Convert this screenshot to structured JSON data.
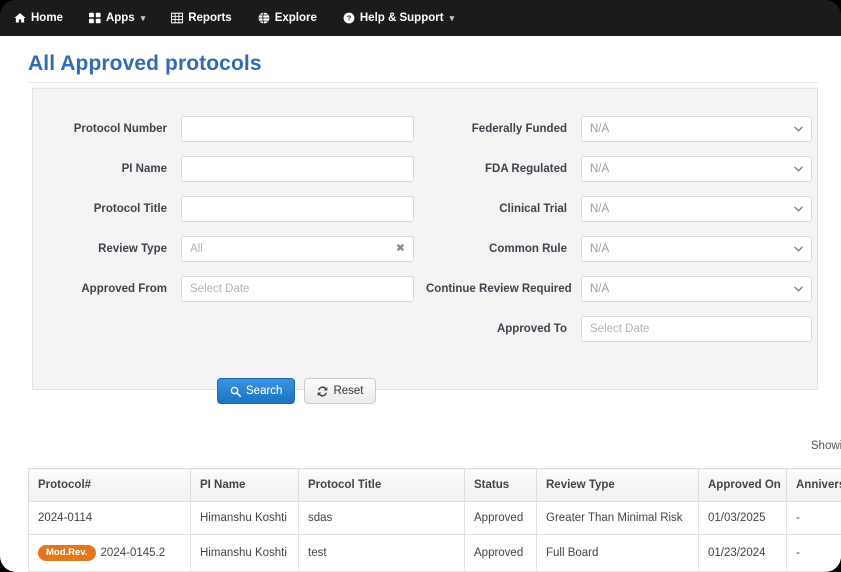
{
  "navbar": {
    "items": [
      {
        "label": "Home",
        "icon": "home-icon",
        "caret": false
      },
      {
        "label": "Apps",
        "icon": "grid-icon",
        "caret": true,
        "caret_glyph": "▾"
      },
      {
        "label": "Reports",
        "icon": "table-icon",
        "caret": false
      },
      {
        "label": "Explore",
        "icon": "globe-icon",
        "caret": false
      },
      {
        "label": "Help & Support",
        "icon": "question-circle-icon",
        "caret": true,
        "caret_glyph": "▾"
      }
    ]
  },
  "page": {
    "title": "All Approved protocols"
  },
  "search_form": {
    "left": [
      {
        "label": "Protocol Number",
        "type": "text",
        "value": "",
        "placeholder": ""
      },
      {
        "label": "PI Name",
        "type": "text",
        "value": "",
        "placeholder": ""
      },
      {
        "label": "Protocol Title",
        "type": "text",
        "value": "",
        "placeholder": ""
      },
      {
        "label": "Review Type",
        "type": "select2",
        "value": "All",
        "clear_glyph": "✖"
      },
      {
        "label": "Approved From",
        "type": "date",
        "value": "",
        "placeholder": "Select Date"
      }
    ],
    "right": [
      {
        "label": "Federally Funded",
        "type": "select",
        "value": "N/A"
      },
      {
        "label": "FDA Regulated",
        "type": "select",
        "value": "N/A"
      },
      {
        "label": "Clinical Trial",
        "type": "select",
        "value": "N/A"
      },
      {
        "label": "Common Rule",
        "type": "select",
        "value": "N/A"
      },
      {
        "label": "Continue Review Required",
        "type": "select",
        "value": "N/A"
      },
      {
        "label": "Approved To",
        "type": "date",
        "value": "",
        "placeholder": "Select Date"
      }
    ],
    "buttons": {
      "search_label": "Search",
      "search_icon": "magnifier-icon",
      "reset_label": "Reset",
      "reset_icon": "refresh-icon"
    }
  },
  "results": {
    "showing_text": "Showing",
    "columns": [
      "Protocol#",
      "PI Name",
      "Protocol Title",
      "Status",
      "Review Type",
      "Approved On",
      "Anniversary"
    ],
    "rows": [
      {
        "badge": "",
        "protocol": "2024-0114",
        "pi_name": "Himanshu Koshti",
        "title": "sdas",
        "status": "Approved",
        "review_type": "Greater Than Minimal Risk",
        "approved_on": "01/03/2025",
        "anniversary": "-"
      },
      {
        "badge": "Mod.Rev.",
        "protocol": "2024-0145.2",
        "pi_name": "Himanshu Koshti",
        "title": "test",
        "status": "Approved",
        "review_type": "Full Board",
        "approved_on": "01/23/2024",
        "anniversary": "-"
      }
    ]
  },
  "colors": {
    "navbar_bg": "#1b1b1b",
    "title_blue": "#2f6cb4",
    "primary_button": "#1a74c4",
    "badge_orange": "#e2761b",
    "panel_bg": "#f4f4f4"
  }
}
